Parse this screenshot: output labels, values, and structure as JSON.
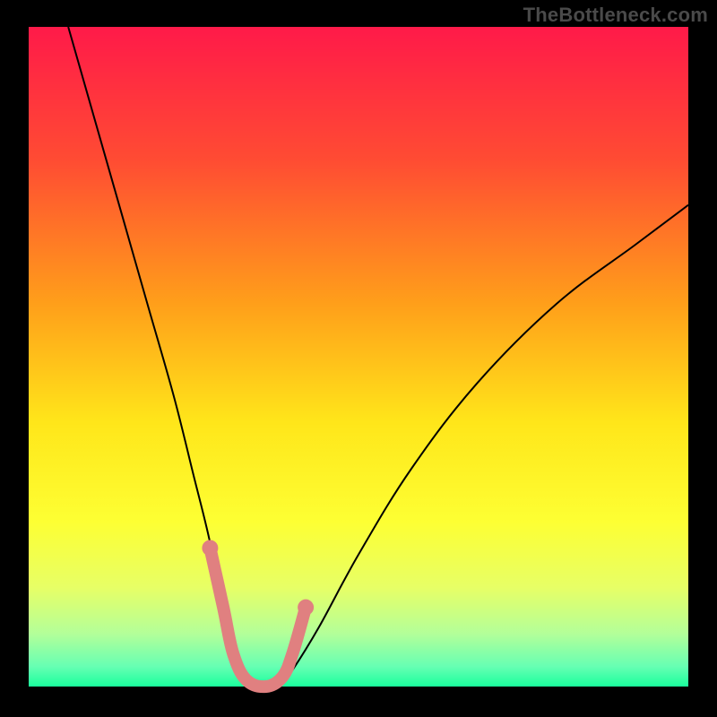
{
  "watermark": "TheBottleneck.com",
  "chart_data": {
    "type": "line",
    "title": "",
    "xlabel": "",
    "ylabel": "",
    "xlim": [
      0,
      100
    ],
    "ylim": [
      0,
      100
    ],
    "background": {
      "type": "vertical_gradient",
      "stops": [
        {
          "pos": 0.0,
          "color": "#ff1a49"
        },
        {
          "pos": 0.2,
          "color": "#ff4b33"
        },
        {
          "pos": 0.42,
          "color": "#ff9f1a"
        },
        {
          "pos": 0.6,
          "color": "#ffe61a"
        },
        {
          "pos": 0.75,
          "color": "#fdff33"
        },
        {
          "pos": 0.85,
          "color": "#e7ff66"
        },
        {
          "pos": 0.92,
          "color": "#b3ff99"
        },
        {
          "pos": 0.97,
          "color": "#66ffb3"
        },
        {
          "pos": 1.0,
          "color": "#1aff9d"
        }
      ]
    },
    "series": [
      {
        "name": "bottleneck_curve",
        "x": [
          6,
          10,
          14,
          18,
          22,
          25,
          27,
          29,
          30.5,
          32,
          34,
          36,
          38,
          40,
          44,
          50,
          58,
          68,
          80,
          92,
          100
        ],
        "y": [
          100,
          86,
          72,
          58,
          44,
          32,
          24,
          15,
          8,
          3,
          0,
          0,
          0,
          2.5,
          9,
          20,
          33,
          46,
          58,
          67,
          73
        ]
      }
    ],
    "highlight": {
      "name": "optimal_zone",
      "x": [
        27.5,
        29.5,
        31,
        33,
        36,
        38.5,
        40,
        42
      ],
      "y": [
        21,
        12,
        5,
        1,
        0,
        1.5,
        5,
        12
      ],
      "dot_indices": [
        0,
        7
      ]
    }
  }
}
